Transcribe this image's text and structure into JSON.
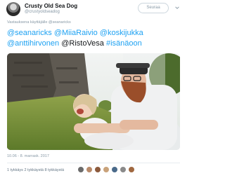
{
  "author": {
    "name": "Crusty Old Sea Dog",
    "handle": "@crustyoldseadog"
  },
  "follow_label": "Seuraa",
  "reply_to": "Vastauksena käyttäjälle @seanaricks",
  "text": {
    "mentions": [
      "@seanaricks",
      "@MiiaRaivio",
      "@koskijukka",
      "@anttihirvonen"
    ],
    "plain_mention": "@RistoVesa",
    "hashtag": "#isänäoon"
  },
  "timestamp": "10.06 - 8. marrask. 2017",
  "stats": "1 tykkäys   2 tykkäystä   8 tykkäystä",
  "colors": {
    "link": "#1da1f2",
    "muted": "#8899a6",
    "text": "#14171a"
  },
  "icons": [
    "chevron-down-icon"
  ]
}
